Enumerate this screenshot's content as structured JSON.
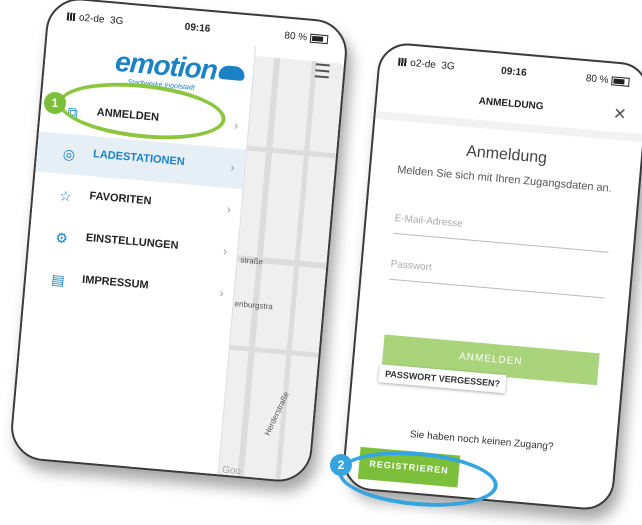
{
  "phone1": {
    "status": {
      "carrier": "o2-de",
      "network": "3G",
      "time": "09:16",
      "battery": "80 %"
    },
    "logo": {
      "word": "emotion",
      "sub": "Stadtwerke Ingolstadt"
    },
    "menu": [
      {
        "label": "ANMELDEN",
        "icon": "external-link-icon"
      },
      {
        "label": "LADESTATIONEN",
        "icon": "location-pin-icon"
      },
      {
        "label": "FAVORITEN",
        "icon": "star-icon"
      },
      {
        "label": "EINSTELLUNGEN",
        "icon": "gear-icon"
      },
      {
        "label": "IMPRESSUM",
        "icon": "document-icon"
      }
    ],
    "map_labels": [
      "straße",
      "enburgstra",
      "Herderstraße",
      "Goo"
    ]
  },
  "phone2": {
    "status": {
      "carrier": "o2-de",
      "network": "3G",
      "time": "09:16",
      "battery": "80 %"
    },
    "title": "ANMELDUNG",
    "heading": "Anmeldung",
    "subtitle": "Melden Sie sich mit Ihren Zugangsdaten an.",
    "email_placeholder": "E-Mail-Adresse",
    "password_placeholder": "Passwort",
    "login_button": "ANMELDEN",
    "forgot_button": "PASSWORT VERGESSEN?",
    "no_access_text": "Sie haben noch keinen Zugang?",
    "register_button": "REGISTRIEREN"
  },
  "annotations": {
    "badge1": "1",
    "badge2": "2"
  },
  "colors": {
    "brand_blue": "#1a82c6",
    "green": "#7cbf3a",
    "light_green": "#a9d47c",
    "annotation_blue": "#35a4df"
  }
}
